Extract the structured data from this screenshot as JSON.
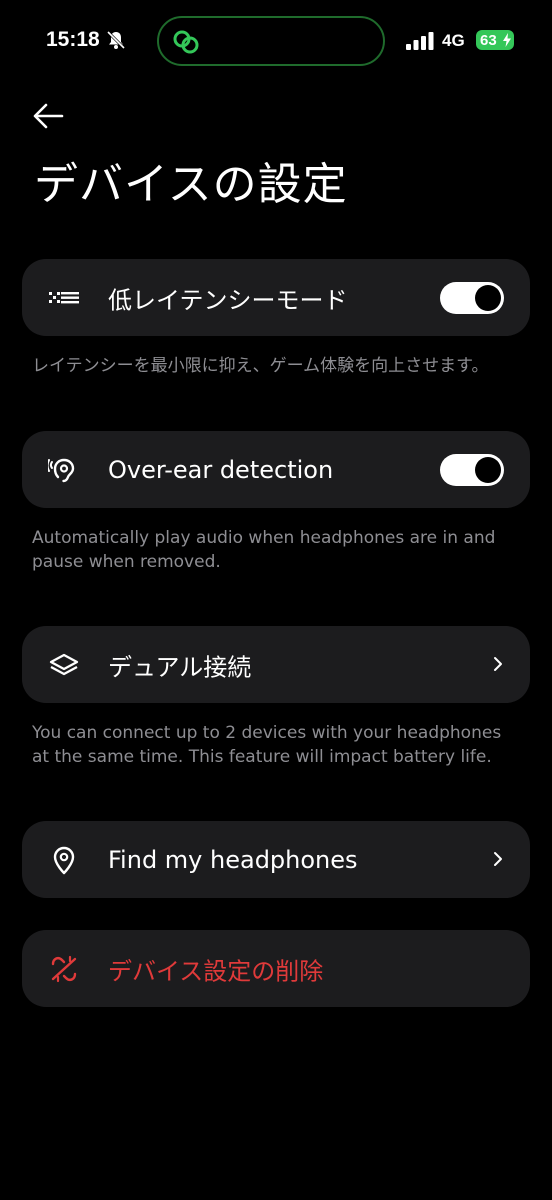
{
  "status_bar": {
    "time": "15:18",
    "network": "4G",
    "battery_level": "63",
    "colors": {
      "battery": "#34c759",
      "island_border": "#1f6b2c"
    }
  },
  "header": {
    "back_icon": "arrow-left-icon",
    "title": "デバイスの設定"
  },
  "settings": {
    "low_latency": {
      "icon": "latency-icon",
      "label": "低レイテンシーモード",
      "enabled": true,
      "description": "レイテンシーを最小限に抑え、ゲーム体験を向上させます。"
    },
    "over_ear": {
      "icon": "ear-detection-icon",
      "label": "Over-ear detection",
      "enabled": true,
      "description": "Automatically play audio when headphones are in and pause when removed."
    },
    "dual_connection": {
      "icon": "layers-icon",
      "label": "デュアル接続",
      "description": "You can connect up to 2 devices with your headphones at the same time. This feature will impact battery life."
    },
    "find_headphones": {
      "icon": "location-pin-icon",
      "label": "Find my headphones"
    },
    "remove_device": {
      "icon": "unlink-icon",
      "label": "デバイス設定の削除",
      "color": "#e03a3a"
    }
  }
}
